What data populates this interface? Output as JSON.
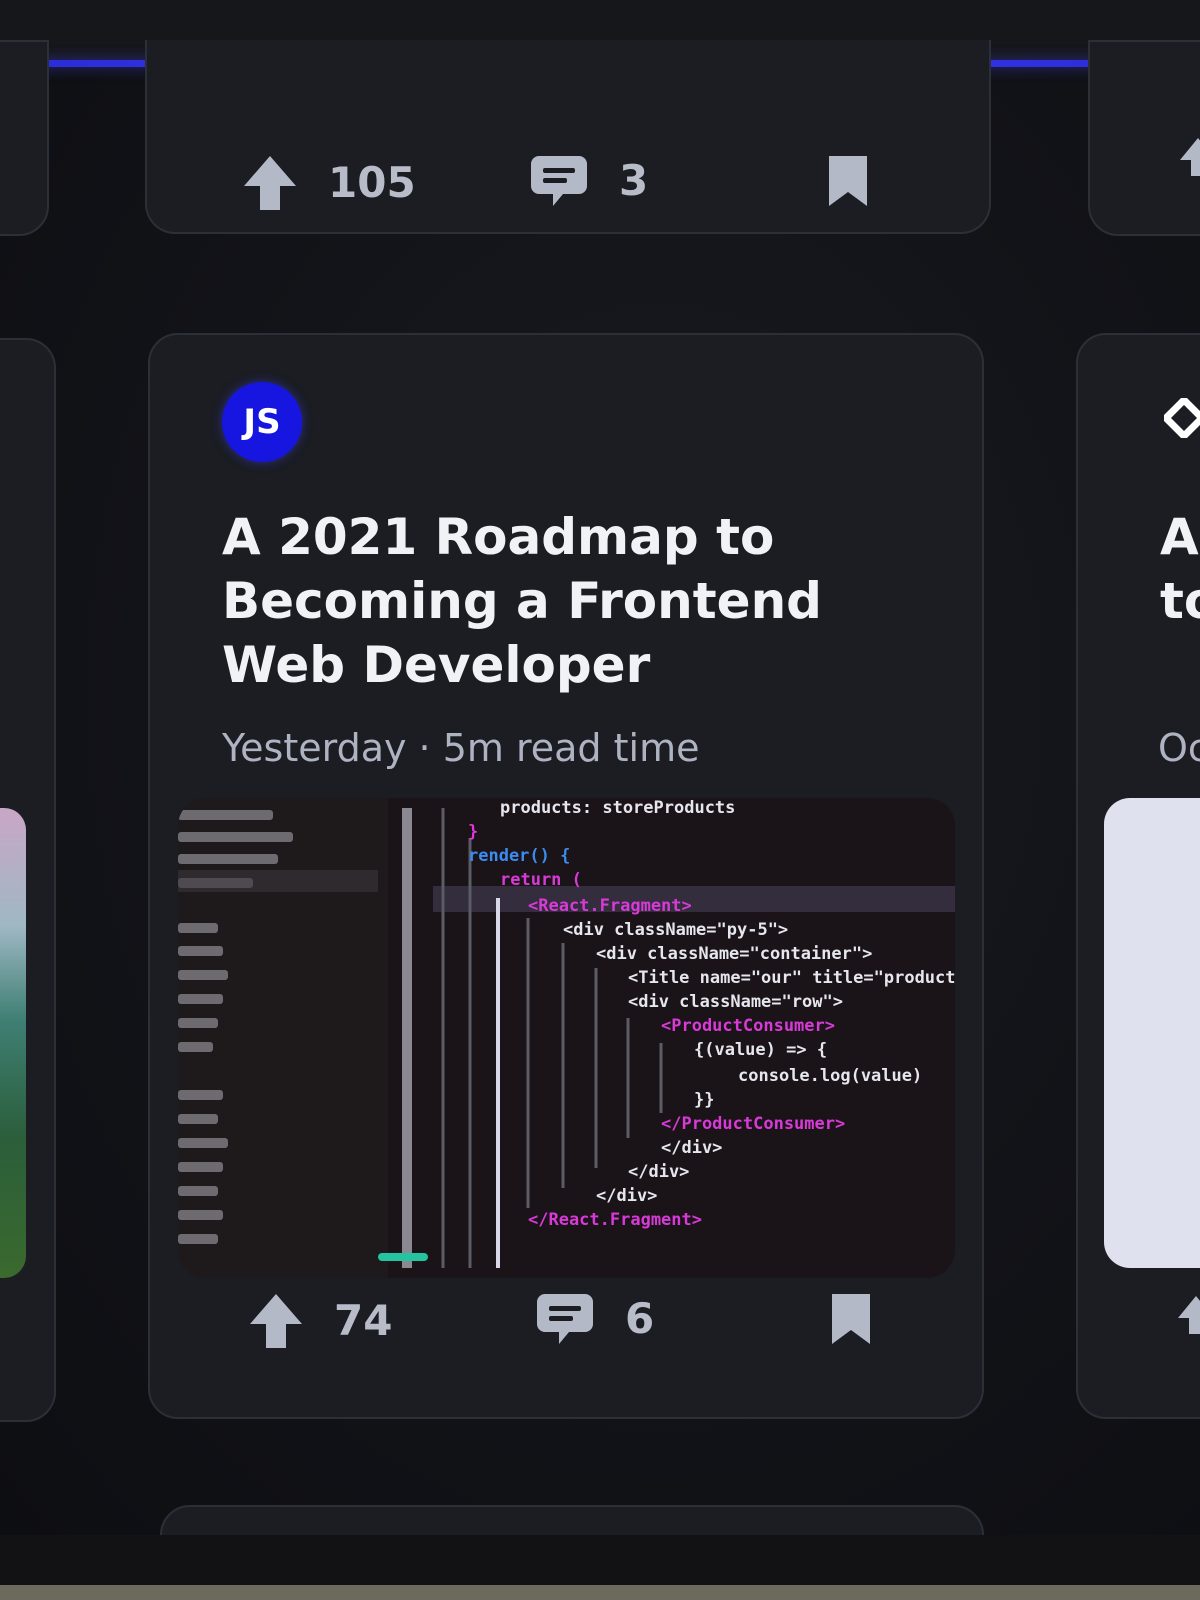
{
  "feed": {
    "top_card": {
      "upvotes": "105",
      "comments": "3"
    },
    "main_card": {
      "source_avatar": "JS",
      "title": "A 2021 Roadmap to Becoming a Frontend Web Developer",
      "meta": "Yesterday · 5m read time",
      "upvotes": "74",
      "comments": "6"
    },
    "right_card": {
      "title_fragment": "A\nto",
      "meta_fragment": "Oc"
    }
  },
  "cover_code": [
    "products: storeProducts",
    "}",
    "render() {",
    "return (",
    "<React.Fragment>",
    "<div className=\"py-5\">",
    "<div className=\"container\">",
    "<Title name=\"our\" title=\"product",
    "<div className=\"row\">",
    "<ProductConsumer>",
    "{(value) => {",
    "console.log(value)",
    "}}",
    "</ProductConsumer>",
    "</div>",
    "</div>",
    "</div>",
    "</React.Fragment>"
  ],
  "icons": {
    "upvote": "arrow-up-icon",
    "comment": "comment-bubble-icon",
    "bookmark": "bookmark-icon",
    "source": "diamond-icon"
  },
  "colors": {
    "accent": "#3b3cf0",
    "avatar": "#1616e0",
    "card": "#1b1d23"
  }
}
